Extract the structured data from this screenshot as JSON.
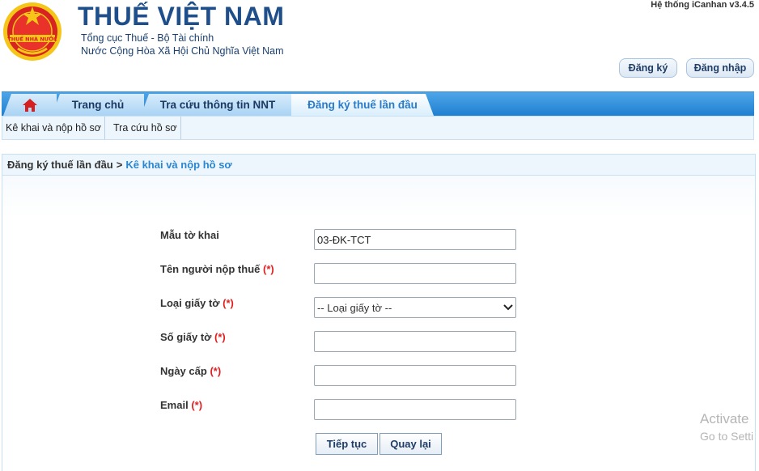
{
  "header": {
    "title": "THUẾ VIỆT NAM",
    "subtitle_1": "Tổng cục Thuế - Bộ Tài chính",
    "subtitle_2": "Nước Cộng Hòa Xã Hội Chủ Nghĩa Việt Nam",
    "version": "Hệ thống iCanhan v3.4.5",
    "logo_text": "THUẾ NHÀ NƯỚC",
    "register_label": "Đăng ký",
    "login_label": "Đăng nhập"
  },
  "nav": {
    "home_icon": "home-icon",
    "tabs": [
      {
        "label": "Trang chủ"
      },
      {
        "label": "Tra cứu thông tin NNT"
      },
      {
        "label": "Đăng ký thuế lần đầu"
      }
    ]
  },
  "subnav": {
    "items": [
      {
        "label": "Kê khai và nộp hồ sơ"
      },
      {
        "label": "Tra cứu hồ sơ"
      }
    ]
  },
  "breadcrumb": {
    "parent": "Đăng ký thuế lần đầu",
    "separator": ">",
    "current": "Kê khai và nộp hồ sơ"
  },
  "form": {
    "required_mark": "(*)",
    "fields": [
      {
        "label": "Mẫu tờ khai",
        "value": "03-ĐK-TCT"
      },
      {
        "label": "Tên người nộp thuế",
        "value": ""
      },
      {
        "label": "Loại giấy tờ",
        "value": "-- Loại giấy tờ --"
      },
      {
        "label": "Số giấy tờ",
        "value": ""
      },
      {
        "label": "Ngày cấp",
        "value": ""
      },
      {
        "label": "Email",
        "value": ""
      }
    ],
    "next_label": "Tiếp tục",
    "back_label": "Quay lại"
  },
  "watermark": {
    "line1": "Activate",
    "line2": "Go to Setti"
  },
  "colors": {
    "brand_blue": "#1f4f8b",
    "nav_blue": "#1f7fd0",
    "active_tab_text": "#2a7bc8",
    "required_red": "#e02020"
  }
}
